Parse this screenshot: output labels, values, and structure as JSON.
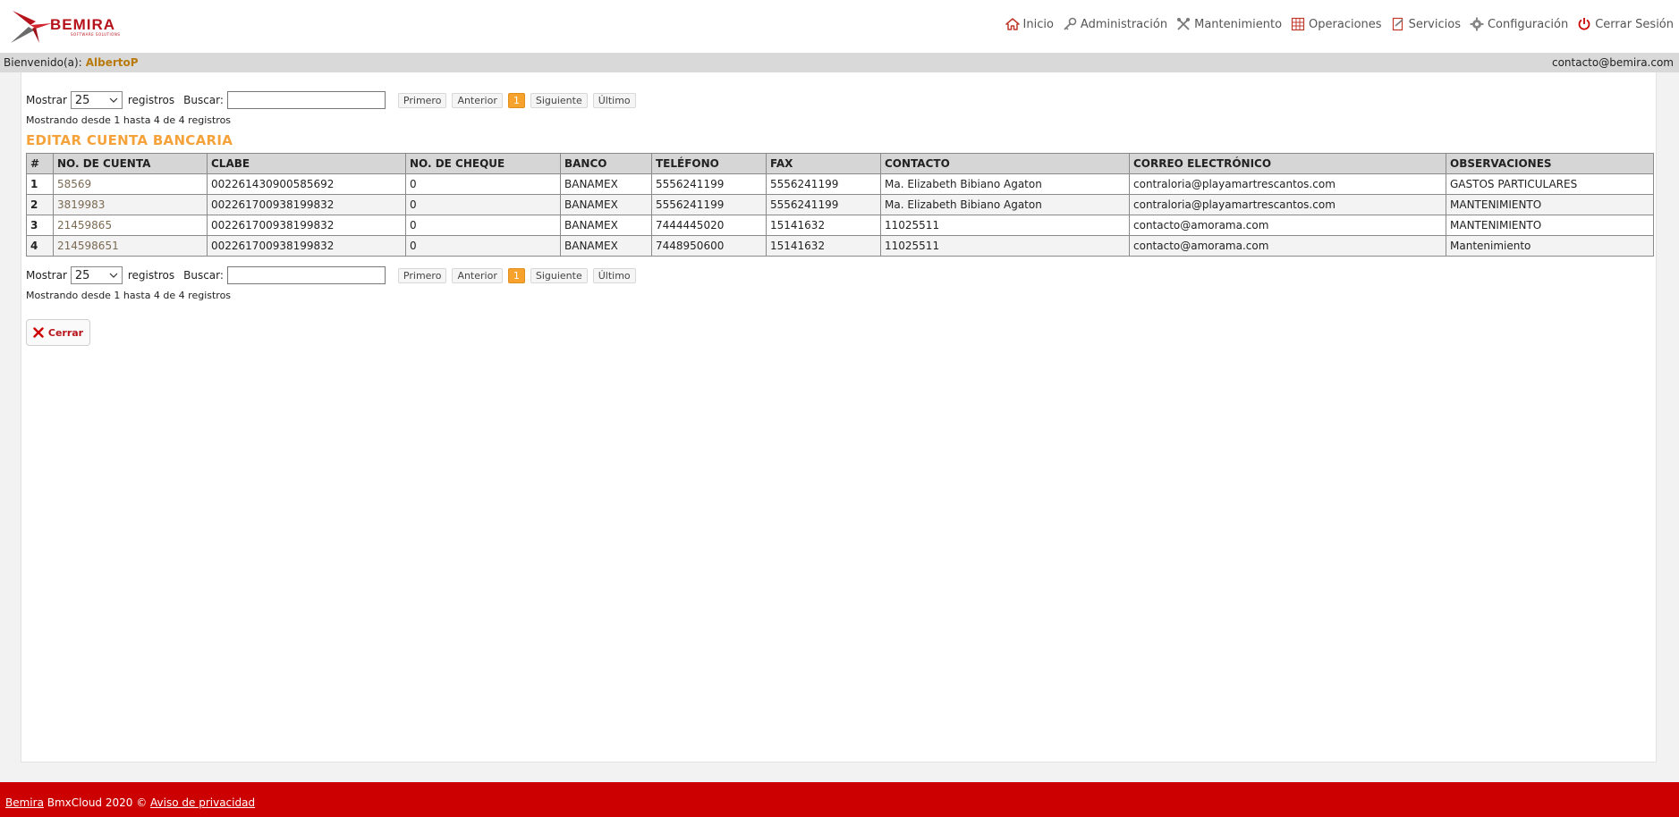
{
  "header": {
    "logo_text": "BEMIRA",
    "logo_subtext": "SOFTWARE SOLUTIONS",
    "nav": [
      {
        "label": "Inicio",
        "icon": "home-icon"
      },
      {
        "label": "Administración",
        "icon": "key-icon"
      },
      {
        "label": "Mantenimiento",
        "icon": "tools-icon"
      },
      {
        "label": "Operaciones",
        "icon": "grid-icon"
      },
      {
        "label": "Servicios",
        "icon": "document-icon"
      },
      {
        "label": "Configuración",
        "icon": "gear-icon"
      },
      {
        "label": "Cerrar Sesión",
        "icon": "power-icon"
      }
    ]
  },
  "welcome": {
    "label": "Bienvenido(a):",
    "user": "AlbertoP",
    "contact_email": "contacto@bemira.com"
  },
  "list_controls": {
    "show_label": "Mostrar",
    "page_size": "25",
    "records_label": "registros",
    "search_label": "Buscar:",
    "search_value": "",
    "pager": {
      "first": "Primero",
      "previous": "Anterior",
      "current_page": "1",
      "next": "Siguiente",
      "last": "Último"
    },
    "info": "Mostrando desde 1 hasta 4 de 4 registros"
  },
  "page_title": "EDITAR CUENTA BANCARIA",
  "table": {
    "columns": [
      "#",
      "NO. DE CUENTA",
      "CLABE",
      "NO. DE CHEQUE",
      "BANCO",
      "TELÉFONO",
      "FAX",
      "CONTACTO",
      "CORREO ELECTRÓNICO",
      "OBSERVACIONES"
    ],
    "rows": [
      [
        "1",
        "58569",
        "002261430900585692",
        "0",
        "BANAMEX",
        "5556241199",
        "5556241199",
        "Ma. Elizabeth Bibiano Agaton",
        "contraloria@playamartrescantos.com",
        "GASTOS PARTICULARES"
      ],
      [
        "2",
        "3819983",
        "002261700938199832",
        "0",
        "BANAMEX",
        "5556241199",
        "5556241199",
        "Ma. Elizabeth Bibiano Agaton",
        "contraloria@playamartrescantos.com",
        "MANTENIMIENTO"
      ],
      [
        "3",
        "21459865",
        "002261700938199832",
        "0",
        "BANAMEX",
        "7444445020",
        "15141632",
        "11025511",
        "contacto@amorama.com",
        "MANTENIMIENTO"
      ],
      [
        "4",
        "214598651",
        "002261700938199832",
        "0",
        "BANAMEX",
        "7448950600",
        "15141632",
        "11025511",
        "contacto@amorama.com",
        "Mantenimiento"
      ]
    ]
  },
  "close_button": {
    "label": "Cerrar",
    "icon": "close-icon"
  },
  "footer": {
    "brand_link": "Bemira",
    "text": " BmxCloud 2020 © ",
    "privacy_link": "Aviso de privacidad"
  },
  "colors": {
    "brand_red": "#cc0000",
    "accent_orange": "#f6a23a",
    "header_gray": "#d9d9d9"
  }
}
